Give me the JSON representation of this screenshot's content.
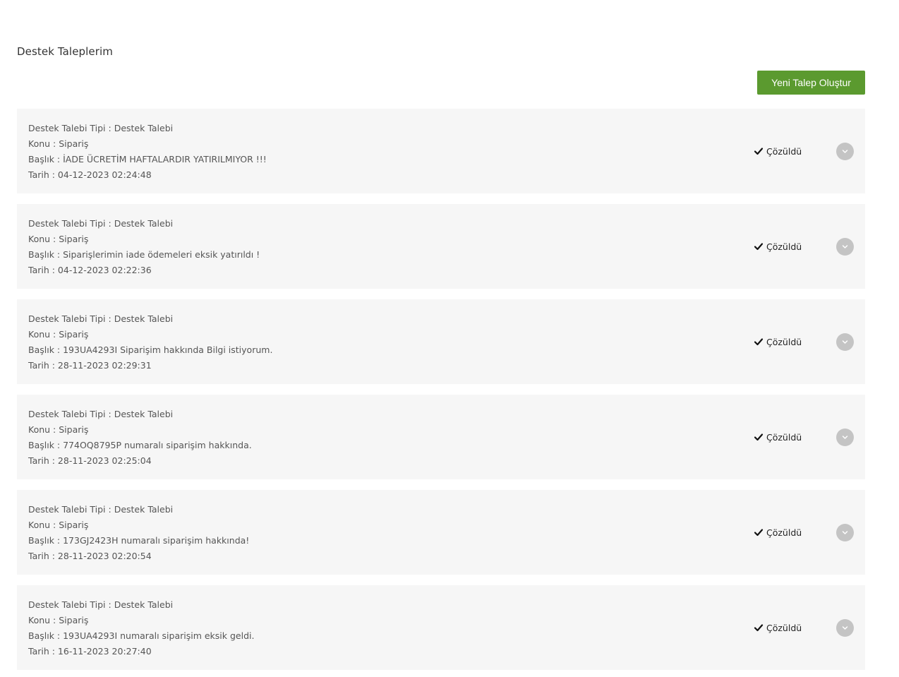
{
  "page": {
    "title": "Destek Taleplerim",
    "new_request_label": "Yeni Talep Oluştur"
  },
  "icons": {
    "status": "check-icon",
    "toggle": "chevron-down-icon"
  },
  "colors": {
    "primary_button": "#5b9a2f",
    "card_background": "#f6f6f6",
    "toggle_background": "#c4c4c4"
  },
  "tickets": [
    {
      "type_line": "Destek Talebi Tipi : Destek Talebi",
      "subject_line": "Konu : Sipariş",
      "title_line": "Başlık : İADE ÜCRETİM HAFTALARDIR YATIRILMIYOR !!!",
      "date_line": "Tarih : 04-12-2023 02:24:48",
      "status": "Çözüldü"
    },
    {
      "type_line": "Destek Talebi Tipi : Destek Talebi",
      "subject_line": "Konu : Sipariş",
      "title_line": "Başlık : Siparişlerimin iade ödemeleri eksik yatırıldı !",
      "date_line": "Tarih : 04-12-2023 02:22:36",
      "status": "Çözüldü"
    },
    {
      "type_line": "Destek Talebi Tipi : Destek Talebi",
      "subject_line": "Konu : Sipariş",
      "title_line": "Başlık : 193UA4293I Siparişim hakkında Bilgi istiyorum.",
      "date_line": "Tarih : 28-11-2023 02:29:31",
      "status": "Çözüldü"
    },
    {
      "type_line": "Destek Talebi Tipi : Destek Talebi",
      "subject_line": "Konu : Sipariş",
      "title_line": "Başlık : 774OQ8795P numaralı siparişim hakkında.",
      "date_line": "Tarih : 28-11-2023 02:25:04",
      "status": "Çözüldü"
    },
    {
      "type_line": "Destek Talebi Tipi : Destek Talebi",
      "subject_line": "Konu : Sipariş",
      "title_line": "Başlık : 173GJ2423H numaralı siparişim hakkında!",
      "date_line": "Tarih : 28-11-2023 02:20:54",
      "status": "Çözüldü"
    },
    {
      "type_line": "Destek Talebi Tipi : Destek Talebi",
      "subject_line": "Konu : Sipariş",
      "title_line": "Başlık : 193UA4293I numaralı siparişim eksik geldi.",
      "date_line": "Tarih : 16-11-2023 20:27:40",
      "status": "Çözüldü"
    }
  ]
}
